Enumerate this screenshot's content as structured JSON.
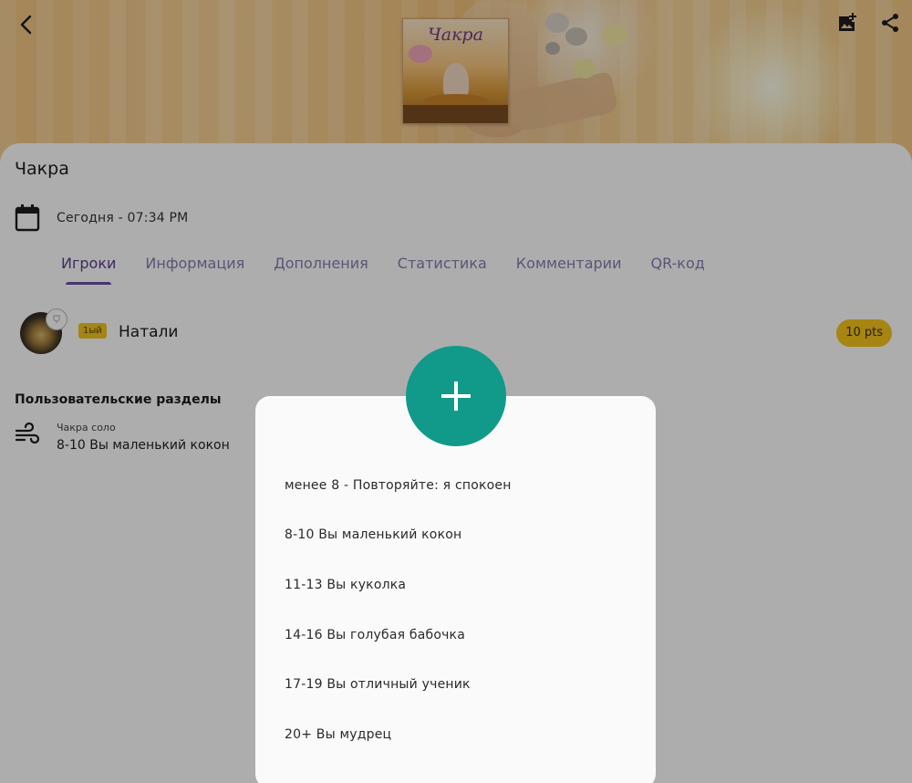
{
  "header": {
    "cover_title": "Чакра",
    "icons": {
      "back": "arrow-back-icon",
      "add_image": "add-photo-icon",
      "share": "share-icon"
    }
  },
  "game": {
    "title": "Чакра",
    "date_icon": "calendar-icon",
    "date_text": "Сегодня - 07:34 PM"
  },
  "tabs": [
    {
      "label": "Игроки",
      "active": true
    },
    {
      "label": "Информация",
      "active": false
    },
    {
      "label": "Дополнения",
      "active": false
    },
    {
      "label": "Статистика",
      "active": false
    },
    {
      "label": "Комментарии",
      "active": false
    },
    {
      "label": "QR-код",
      "active": false
    }
  ],
  "players": [
    {
      "rank": "1ый",
      "name": "Натали",
      "score": "10 pts"
    }
  ],
  "custom_sections": {
    "title": "Пользовательские разделы",
    "items": [
      {
        "icon": "wind-icon",
        "label": "Чакра соло",
        "value": "8-10 Вы маленький кокон"
      }
    ]
  },
  "dialog": {
    "fab_icon": "plus-icon",
    "options": [
      "менее 8 - Повторяйте: я спокоен",
      "8-10 Вы маленький кокон",
      "11-13 Вы куколка",
      "14-16 Вы голубая бабочка",
      "17-19 Вы отличный ученик",
      "20+ Вы мудрец"
    ]
  },
  "colors": {
    "accent_purple": "#6d4ba8",
    "badge_yellow": "#f5c51d",
    "fab_teal": "#11998a"
  }
}
